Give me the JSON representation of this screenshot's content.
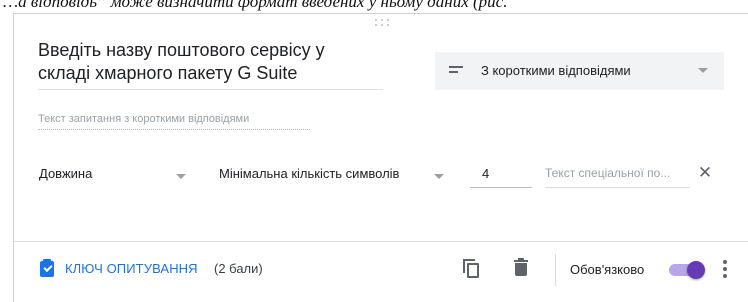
{
  "document": {
    "top_text": "…а відповідь” може визначити формат введених у ньому даних (рис."
  },
  "question": {
    "title": "Введіть назву поштового сервісу у складі хмарного пакету G Suite",
    "title_line1": "Введіть назву поштового сервісу у",
    "title_line2": "складі хмарного пакету G Suite",
    "type_label": "З короткими відповідями",
    "answer_placeholder": "Текст запитання з короткими відповідями"
  },
  "validation": {
    "type": "Довжина",
    "rule": "Мінімальна кількість символів",
    "value": "4",
    "custom_error_placeholder": "Текст спеціальної по..."
  },
  "footer": {
    "answer_key_label": "КЛЮЧ ОПИТУВАННЯ",
    "points": "(2 бали)",
    "required_label": "Обов'язково",
    "required_on": true
  },
  "icons": {
    "short_answer": "short-text-icon",
    "answer_key": "assignment-check-icon",
    "duplicate": "content-copy-icon",
    "delete": "trash-icon",
    "more": "more-vert-icon",
    "close": "close-icon"
  },
  "colors": {
    "accent_blue": "#1a73e8",
    "toggle_purple": "#673ab7"
  }
}
